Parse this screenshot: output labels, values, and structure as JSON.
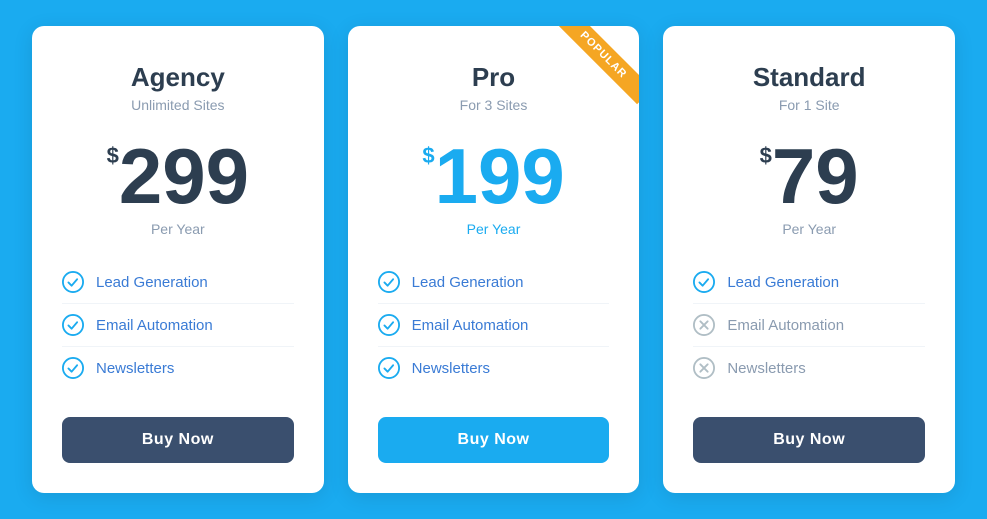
{
  "background_color": "#1aabf0",
  "plans": [
    {
      "id": "agency",
      "name": "Agency",
      "subtitle": "Unlimited Sites",
      "price_symbol": "$",
      "price_amount": "299",
      "price_period": "Per Year",
      "featured": false,
      "popular_label": "",
      "price_color": "dark",
      "btn_label": "Buy Now",
      "btn_style": "dark",
      "features": [
        {
          "label": "Lead Generation",
          "included": true
        },
        {
          "label": "Email Automation",
          "included": true
        },
        {
          "label": "Newsletters",
          "included": true
        }
      ]
    },
    {
      "id": "pro",
      "name": "Pro",
      "subtitle": "For 3 Sites",
      "price_symbol": "$",
      "price_amount": "199",
      "price_period": "Per Year",
      "featured": true,
      "popular_label": "POPULAR",
      "price_color": "blue",
      "btn_label": "Buy Now",
      "btn_style": "blue",
      "features": [
        {
          "label": "Lead Generation",
          "included": true
        },
        {
          "label": "Email Automation",
          "included": true
        },
        {
          "label": "Newsletters",
          "included": true
        }
      ]
    },
    {
      "id": "standard",
      "name": "Standard",
      "subtitle": "For 1 Site",
      "price_symbol": "$",
      "price_amount": "79",
      "price_period": "Per Year",
      "featured": false,
      "popular_label": "",
      "price_color": "dark",
      "btn_label": "Buy Now",
      "btn_style": "dark",
      "features": [
        {
          "label": "Lead Generation",
          "included": true
        },
        {
          "label": "Email Automation",
          "included": false
        },
        {
          "label": "Newsletters",
          "included": false
        }
      ]
    }
  ]
}
